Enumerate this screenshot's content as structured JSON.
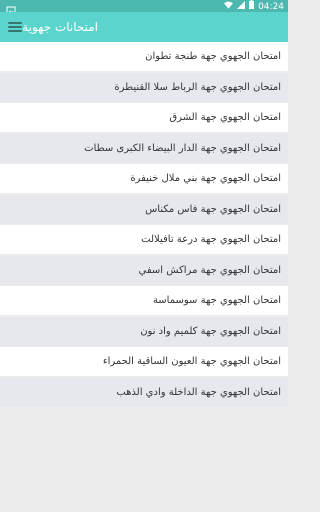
{
  "status_bar": {
    "time": "04:24"
  },
  "app_bar": {
    "title": "امتحانات جهوية"
  },
  "items": [
    {
      "label": "امتحان الجهوي جهة طنجة تطوان"
    },
    {
      "label": "امتحان الجهوي جهة الرباط سلا القنيطرة"
    },
    {
      "label": "امتحان الجهوي جهة الشرق"
    },
    {
      "label": "امتحان الجهوي جهة الدار البيضاء الكبرى سطات"
    },
    {
      "label": "امتحان الجهوي جهة بني ملال خنيفرة"
    },
    {
      "label": "امتحان الجهوي جهة فاس مكناس"
    },
    {
      "label": "امتحان الجهوي جهة درعة تافيلالت"
    },
    {
      "label": "امتحان الجهوي جهة مراكش اسفي"
    },
    {
      "label": "امتحان الجهوي جهة سوسماسة"
    },
    {
      "label": "امتحان الجهوي جهة كلميم واد نون"
    },
    {
      "label": "امتحان الجهوي جهة العيون الساقية الحمراء"
    },
    {
      "label": "امتحان الجهوي جهة الداخلة وادي الذهب"
    }
  ]
}
